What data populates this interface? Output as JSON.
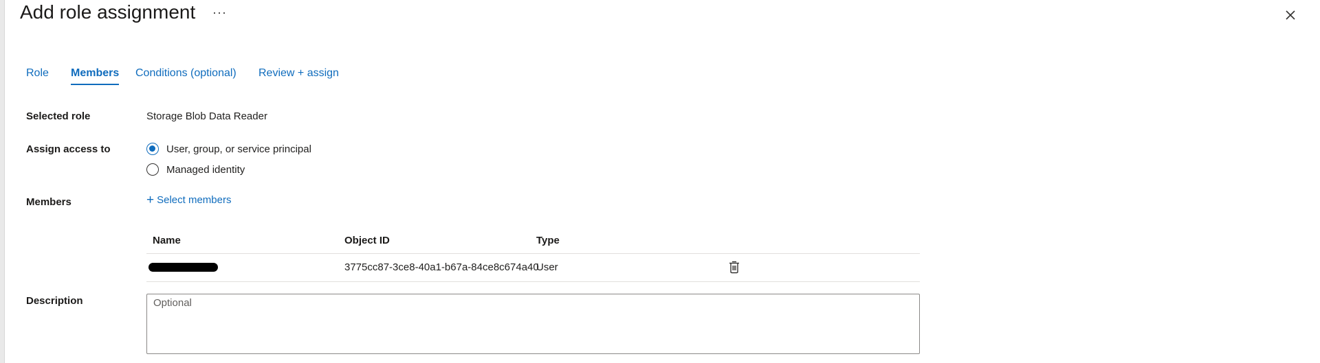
{
  "header": {
    "title": "Add role assignment",
    "more_label": "···"
  },
  "tabs": [
    {
      "label": "Role",
      "active": false
    },
    {
      "label": "Members",
      "active": true
    },
    {
      "label": "Conditions (optional)",
      "active": false
    },
    {
      "label": "Review + assign",
      "active": false
    }
  ],
  "form": {
    "selected_role_label": "Selected role",
    "selected_role_value": "Storage Blob Data Reader",
    "assign_access_label": "Assign access to",
    "assign_options": [
      {
        "label": "User, group, or service principal",
        "checked": true
      },
      {
        "label": "Managed identity",
        "checked": false
      }
    ],
    "members_label": "Members",
    "select_members_label": "Select members",
    "description_label": "Description",
    "description_placeholder": "Optional"
  },
  "members_table": {
    "columns": [
      "Name",
      "Object ID",
      "Type"
    ],
    "rows": [
      {
        "name": "",
        "object_id": "3775cc87-3ce8-40a1-b67a-84ce8c674a40",
        "type": "User"
      }
    ]
  },
  "icons": {
    "close": "close-icon",
    "delete": "trash-icon",
    "plus": "plus-icon"
  },
  "colors": {
    "accent": "#0f6cbd"
  }
}
